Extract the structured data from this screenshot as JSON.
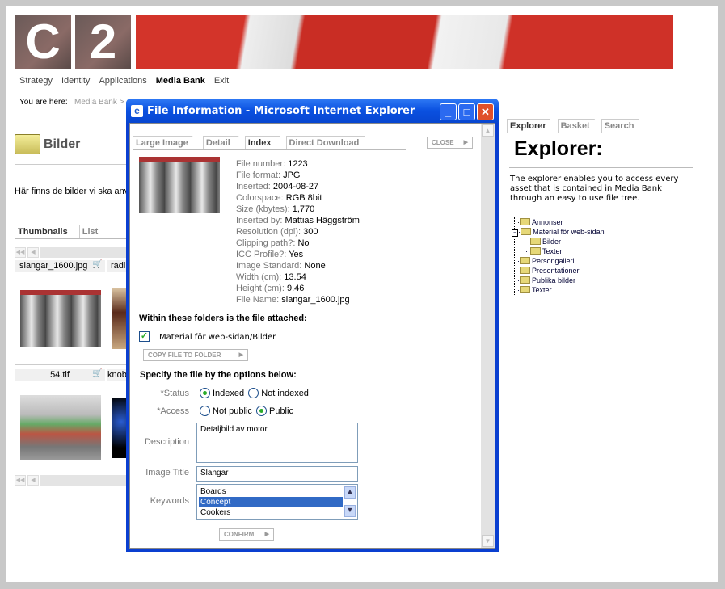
{
  "header": {
    "logo_tiles": [
      "C",
      "2"
    ]
  },
  "nav": {
    "items": [
      "Strategy",
      "Identity",
      "Applications",
      "Media Bank",
      "Exit"
    ],
    "active": "Media Bank"
  },
  "breadcrumb": {
    "label": "You are here:",
    "path": "Media Bank >"
  },
  "folder": {
    "title": "Bilder",
    "description": "Här finns de bilder vi ska anv"
  },
  "view_tabs": [
    "Thumbnails",
    "List"
  ],
  "thumbnails": [
    {
      "name": "slangar_1600.jpg"
    },
    {
      "name": "radi"
    },
    {
      "name": "54.tif"
    },
    {
      "name": "knob"
    }
  ],
  "popup": {
    "title": "File Information - Microsoft Internet Explorer",
    "tabs": [
      "Large Image",
      "Detail",
      "Index",
      "Direct Download"
    ],
    "active_tab": "Index",
    "close_label": "CLOSE",
    "info": [
      {
        "k": "File number:",
        "v": "1223"
      },
      {
        "k": "File format:",
        "v": "JPG"
      },
      {
        "k": "Inserted:",
        "v": "2004-08-27"
      },
      {
        "k": "Colorspace:",
        "v": "RGB 8bit"
      },
      {
        "k": "Size (kbytes):",
        "v": "1,770"
      },
      {
        "k": "Inserted by:",
        "v": "Mattias Häggström"
      },
      {
        "k": "Resolution (dpi):",
        "v": "300"
      },
      {
        "k": "Clipping path?:",
        "v": "No"
      },
      {
        "k": "ICC Profile?:",
        "v": "Yes"
      },
      {
        "k": "Image Standard:",
        "v": "None"
      },
      {
        "k": "Width (cm):",
        "v": "13.54"
      },
      {
        "k": "Height (cm):",
        "v": "9.46"
      },
      {
        "k": "File Name:",
        "v": "slangar_1600.jpg"
      }
    ],
    "folders_heading": "Within these folders is the file attached:",
    "folder_checkbox": {
      "label": "Material för web-sidan/Bilder",
      "checked": true
    },
    "copy_label": "COPY FILE TO FOLDER",
    "options_heading": "Specify the file by the options below:",
    "status": {
      "label": "*Status",
      "options": [
        "Indexed",
        "Not indexed"
      ],
      "selected": "Indexed"
    },
    "access": {
      "label": "*Access",
      "options": [
        "Not public",
        "Public"
      ],
      "selected": "Public"
    },
    "description": {
      "label": "Description",
      "value": "Detaljbild av motor"
    },
    "image_title": {
      "label": "Image Title",
      "value": "Slangar"
    },
    "keywords": {
      "label": "Keywords",
      "options": [
        "Boards",
        "Concept",
        "Cookers"
      ],
      "selected": "Concept"
    },
    "confirm_label": "CONFIRM"
  },
  "right": {
    "tabs": [
      "Explorer",
      "Basket",
      "Search"
    ],
    "heading": "Explorer:",
    "text": "The explorer enables you to access every asset that is contained in Media Bank through an easy to use file tree.",
    "tree": [
      "Annonser",
      "Material för web-sidan",
      "Bilder",
      "Texter",
      "Persongalleri",
      "Presentationer",
      "Publika bilder",
      "Texter"
    ]
  },
  "colors": {
    "titlebar": "#0a50e0",
    "selection": "#316ac5",
    "logo_red": "#d3342a"
  }
}
